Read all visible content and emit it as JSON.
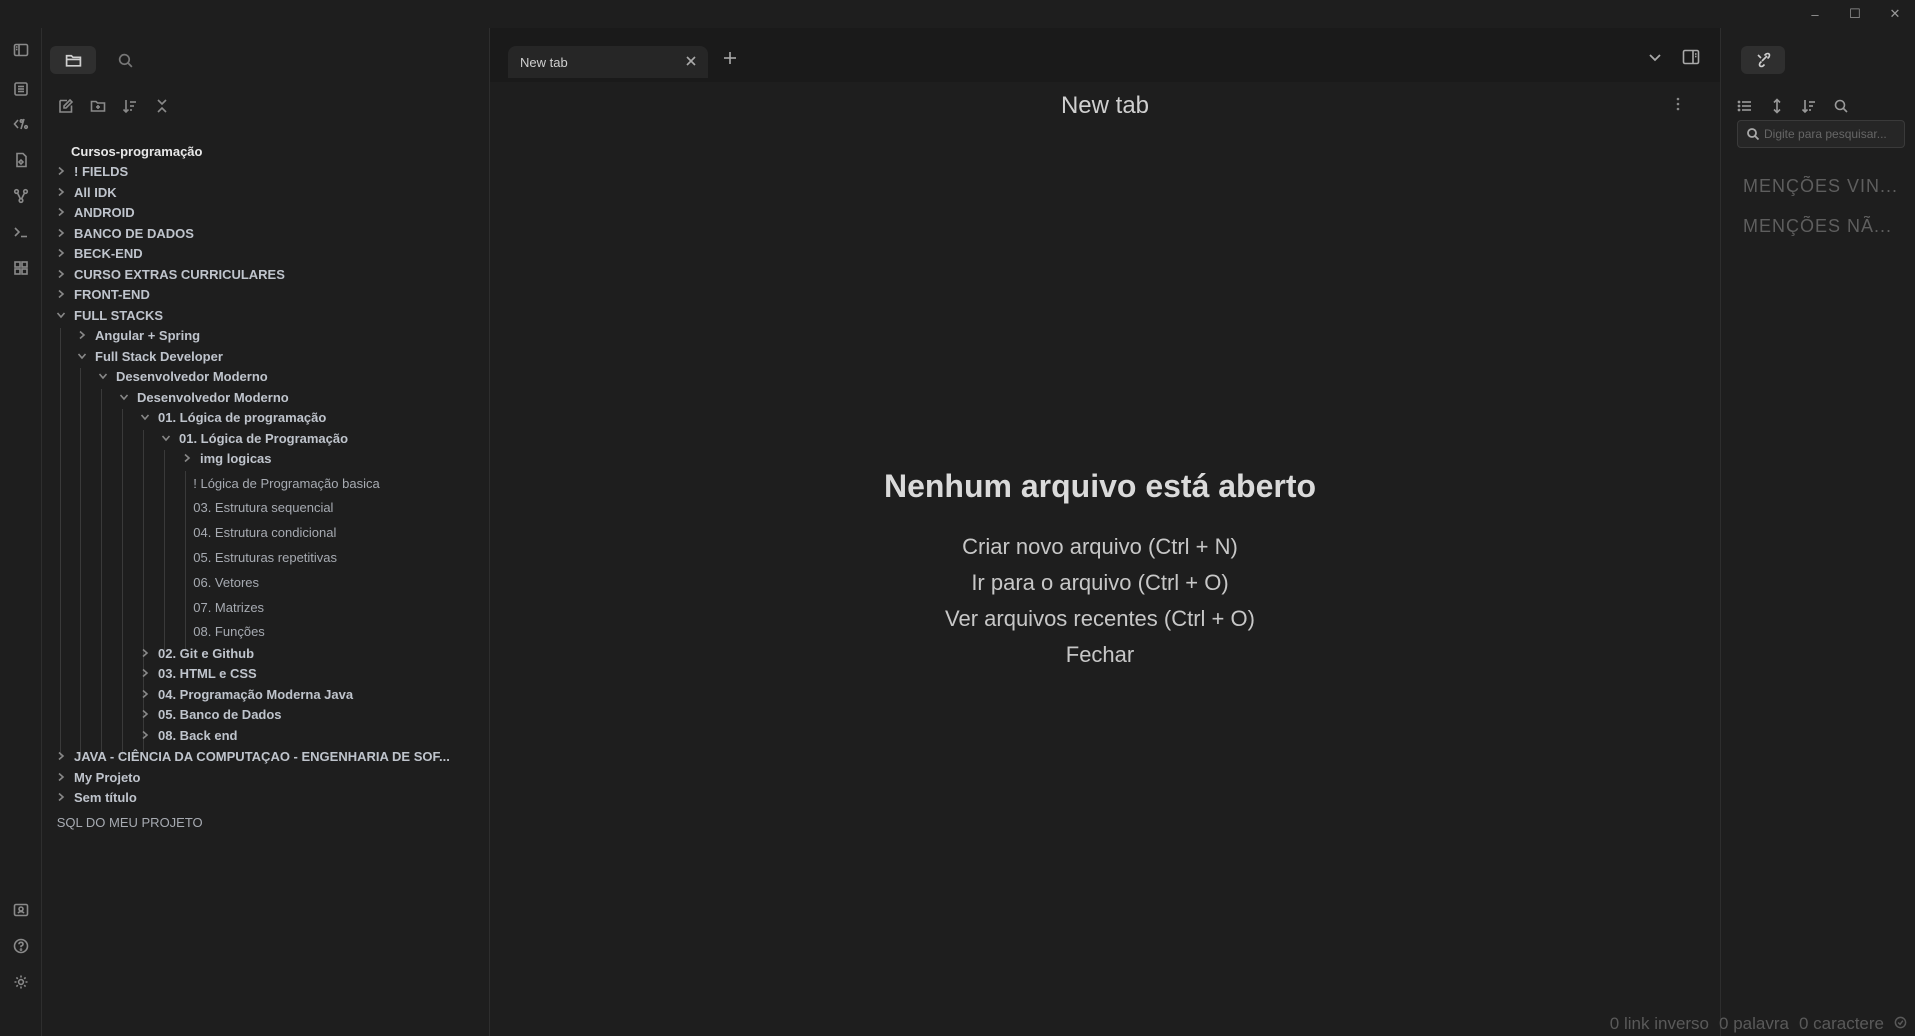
{
  "window": {
    "controls": [
      "–",
      "☐",
      "✕"
    ]
  },
  "ribbon": {
    "items": [
      {
        "name": "toggle-sidebar-icon"
      },
      {
        "name": "open-quick-switcher-icon"
      },
      {
        "name": "templates-icon"
      },
      {
        "name": "open-daily-note-icon"
      },
      {
        "name": "graph-view-icon"
      },
      {
        "name": "command-palette-icon"
      },
      {
        "name": "slides-icon"
      },
      {
        "name": "vault-switch-icon"
      },
      {
        "name": "help-icon"
      },
      {
        "name": "settings-icon"
      }
    ]
  },
  "explorer": {
    "vault_name": "Cursos-programação",
    "tree": [
      {
        "label": "! FIELDS",
        "type": "folder"
      },
      {
        "label": "All IDK",
        "type": "folder"
      },
      {
        "label": "ANDROID",
        "type": "folder"
      },
      {
        "label": "BANCO DE DADOS",
        "type": "folder"
      },
      {
        "label": "BECK-END",
        "type": "folder"
      },
      {
        "label": "CURSO EXTRAS CURRICULARES",
        "type": "folder"
      },
      {
        "label": "FRONT-END",
        "type": "folder"
      },
      {
        "label": "FULL STACKS",
        "type": "folder",
        "open": true
      },
      {
        "label": "Angular + Spring",
        "type": "folder"
      },
      {
        "label": "Full Stack Developer",
        "type": "folder",
        "open": true
      },
      {
        "label": "Desenvolvedor Moderno",
        "type": "folder",
        "open": true
      },
      {
        "label": "Desenvolvedor Moderno",
        "type": "folder",
        "open": true
      },
      {
        "label": "01. Lógica de programação",
        "type": "folder",
        "open": true
      },
      {
        "label": "01. Lógica de Programação",
        "type": "folder",
        "open": true
      },
      {
        "label": "img logicas",
        "type": "folder"
      },
      {
        "label": "! Lógica de Programação basica",
        "type": "file"
      },
      {
        "label": "03. Estrutura sequencial",
        "type": "file"
      },
      {
        "label": "04. Estrutura condicional",
        "type": "file"
      },
      {
        "label": "05. Estruturas repetitivas",
        "type": "file"
      },
      {
        "label": "06. Vetores",
        "type": "file"
      },
      {
        "label": "07. Matrizes",
        "type": "file"
      },
      {
        "label": "08. Funções",
        "type": "file"
      },
      {
        "label": "02. Git e Github",
        "type": "folder"
      },
      {
        "label": "03. HTML e CSS",
        "type": "folder"
      },
      {
        "label": "04. Programação Moderna Java",
        "type": "folder"
      },
      {
        "label": "05. Banco de Dados",
        "type": "folder"
      },
      {
        "label": "08. Back end",
        "type": "folder"
      },
      {
        "label": "JAVA - CIÊNCIA DA COMPUTAÇAO - ENGENHARIA DE SOF...",
        "type": "folder"
      },
      {
        "label": "My Projeto",
        "type": "folder"
      },
      {
        "label": "Sem título",
        "type": "folder"
      },
      {
        "label": "SQL DO MEU PROJETO",
        "type": "file"
      }
    ]
  },
  "tabs": {
    "items": [
      {
        "label": "New tab"
      }
    ]
  },
  "view": {
    "title": "New tab",
    "empty_heading": "Nenhum arquivo está aberto",
    "actions": [
      "Criar novo arquivo (Ctrl + N)",
      "Ir para o arquivo (Ctrl + O)",
      "Ver arquivos recentes (Ctrl + O)",
      "Fechar"
    ]
  },
  "right_panel": {
    "search_placeholder": "Digite para pesquisar...",
    "sections": [
      "MENÇÕES VIN...",
      "MENÇÕES NÃ..."
    ]
  },
  "status": {
    "backlinks": "0 link inverso",
    "words": "0 palavra",
    "chars": "0 caractere"
  }
}
